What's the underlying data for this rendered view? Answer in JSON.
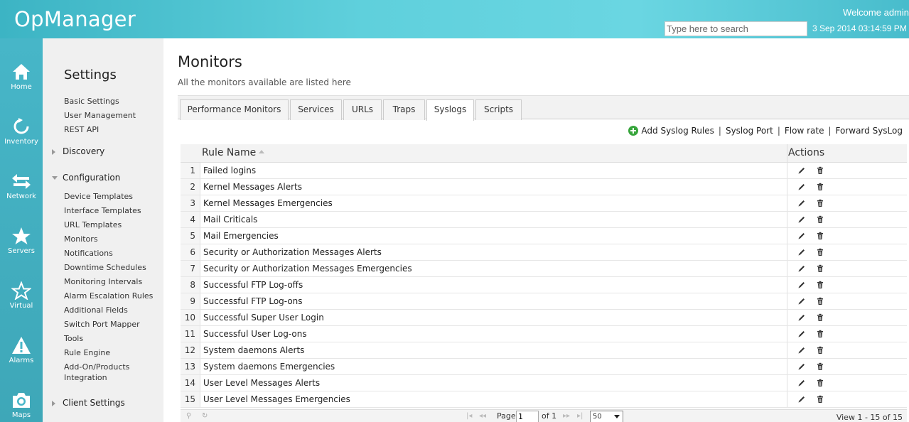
{
  "app": {
    "title": "OpManager",
    "welcome": "Welcome admin",
    "search_placeholder": "Type here to search",
    "datetime": "3 Sep 2014 03:14:59 PM"
  },
  "leftnav": {
    "items": [
      {
        "label": "Home",
        "icon": "home-icon"
      },
      {
        "label": "Inventory",
        "icon": "refresh-icon"
      },
      {
        "label": "Network",
        "icon": "arrows-icon"
      },
      {
        "label": "Servers",
        "icon": "star-filled-icon"
      },
      {
        "label": "Virtual",
        "icon": "star-outline-icon"
      },
      {
        "label": "Alarms",
        "icon": "warning-icon"
      },
      {
        "label": "Maps",
        "icon": "camera-icon"
      }
    ]
  },
  "sidebar": {
    "title": "Settings",
    "top_links": [
      "Basic Settings",
      "User Management",
      "REST API"
    ],
    "discovery": "Discovery",
    "configuration": "Configuration",
    "config_links": [
      "Device Templates",
      "Interface Templates",
      "URL Templates",
      "Monitors",
      "Notifications",
      "Downtime Schedules",
      "Monitoring Intervals",
      "Alarm Escalation Rules",
      "Additional Fields",
      "Switch Port Mapper",
      "Tools",
      "Rule Engine",
      "Add-On/Products",
      "Integration"
    ],
    "client_settings": "Client Settings"
  },
  "main": {
    "title": "Monitors",
    "subtitle": "All the monitors available are listed here",
    "tabs": [
      "Performance Monitors",
      "Services",
      "URLs",
      "Traps",
      "Syslogs",
      "Scripts"
    ],
    "active_tab": "Syslogs",
    "actions": {
      "add": "Add Syslog Rules",
      "port": "Syslog Port",
      "flow": "Flow rate",
      "forward": "Forward SysLog",
      "sep": "|"
    },
    "table": {
      "col_name": "Rule Name",
      "col_actions": "Actions",
      "rows": [
        {
          "num": "1",
          "name": "Failed logins"
        },
        {
          "num": "2",
          "name": "Kernel Messages Alerts"
        },
        {
          "num": "3",
          "name": "Kernel Messages Emergencies"
        },
        {
          "num": "4",
          "name": "Mail Criticals"
        },
        {
          "num": "5",
          "name": "Mail Emergencies"
        },
        {
          "num": "6",
          "name": "Security or Authorization Messages Alerts"
        },
        {
          "num": "7",
          "name": "Security or Authorization Messages Emergencies"
        },
        {
          "num": "8",
          "name": "Successful FTP Log-offs"
        },
        {
          "num": "9",
          "name": "Successful FTP Log-ons"
        },
        {
          "num": "10",
          "name": "Successful Super User Login"
        },
        {
          "num": "11",
          "name": "Successful User Log-ons"
        },
        {
          "num": "12",
          "name": "System daemons Alerts"
        },
        {
          "num": "13",
          "name": "System daemons Emergencies"
        },
        {
          "num": "14",
          "name": "User Level Messages Alerts"
        },
        {
          "num": "15",
          "name": "User Level Messages Emergencies"
        }
      ]
    },
    "pager": {
      "page_label": "Page",
      "page_value": "1",
      "of_label": "of 1",
      "page_size": "50",
      "view": "View 1 - 15 of 15"
    }
  },
  "colors": {
    "header": "#5fd0dc",
    "nav": "#47b6c8",
    "add_icon": "#37a53c"
  }
}
